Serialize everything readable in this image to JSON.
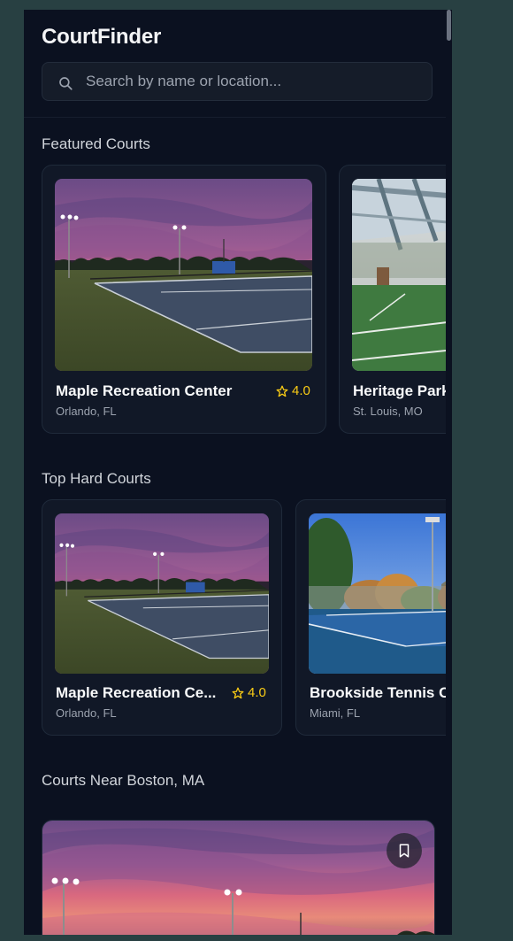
{
  "app": {
    "title": "CourtFinder"
  },
  "search": {
    "placeholder": "Search by name or location..."
  },
  "sections": {
    "featured": {
      "title": "Featured Courts",
      "cards": [
        {
          "name": "Maple Recreation Center",
          "location": "Orlando, FL",
          "rating": "4.0",
          "image": "sunset-outdoor-court"
        },
        {
          "name": "Heritage Park",
          "location": "St. Louis, MO",
          "image": "indoor-court"
        }
      ]
    },
    "hard": {
      "title": "Top Hard Courts",
      "cards": [
        {
          "name": "Maple Recreation Ce...",
          "location": "Orlando, FL",
          "rating": "4.0",
          "image": "sunset-outdoor-court"
        },
        {
          "name": "Brookside Tennis C",
          "location": "Miami, FL",
          "image": "daytime-blue-court"
        }
      ]
    },
    "near": {
      "title": "Courts Near Boston, MA"
    }
  },
  "icons": {
    "search": "search-icon",
    "star": "star-outline-icon",
    "bookmark": "bookmark-icon"
  },
  "colors": {
    "background": "#0b1120",
    "card": "#111827",
    "accent_rating": "#facc15",
    "outer": "#284042"
  }
}
